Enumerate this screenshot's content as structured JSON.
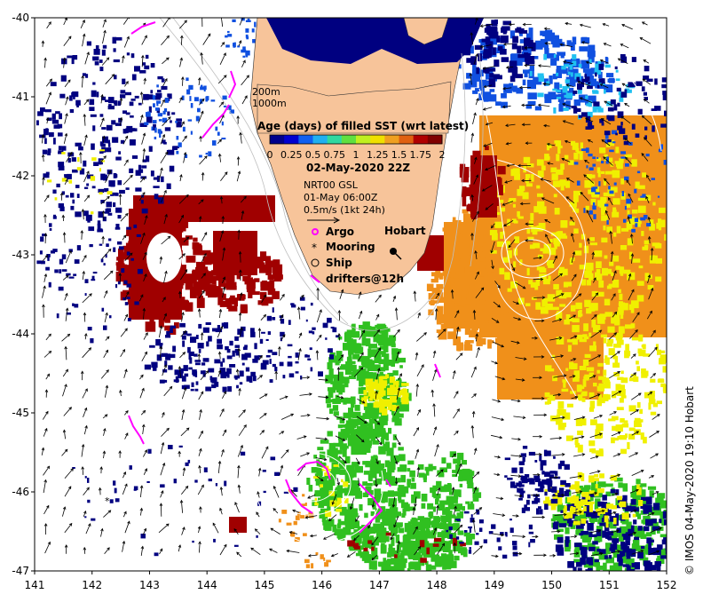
{
  "map": {
    "lon_ticks": [
      "141",
      "142",
      "143",
      "144",
      "145",
      "146",
      "147",
      "148",
      "149",
      "150",
      "151",
      "152"
    ],
    "lat_ticks": [
      "-40",
      "-41",
      "-42",
      "-43",
      "-44",
      "-45",
      "-46",
      "-47"
    ],
    "lon_range": [
      141,
      152
    ],
    "lat_range": [
      -47,
      -40
    ]
  },
  "legend": {
    "depth_200": "200m",
    "depth_1000": "1000m",
    "colorbar_title": "Age (days) of filled SST (wrt latest)",
    "colorbar_ticks": [
      "0",
      "0.25",
      "0.5",
      "0.75",
      "1",
      "1.25",
      "1.5",
      "1.75",
      "2"
    ],
    "date": "02-May-2020 22Z",
    "current_source": "NRT00 GSL",
    "current_time": "01-May 06:00Z",
    "scale_label": "0.5m/s (1kt 24h)",
    "argo": "Argo",
    "mooring": "Mooring",
    "ship": "Ship",
    "drifters": "drifters@12h"
  },
  "place": {
    "hobart": "Hobart"
  },
  "credit": "© IMOS 04-May-2020 19:10 Hobart",
  "colors": {
    "land": "#f7c49a",
    "deep_blue": "#000080",
    "blue": "#1050e0",
    "cyan": "#20c0f0",
    "green": "#30c020",
    "yellow": "#f0f000",
    "orange": "#f0901a",
    "dark_red": "#a00000",
    "drifter": "#ff00ff"
  }
}
